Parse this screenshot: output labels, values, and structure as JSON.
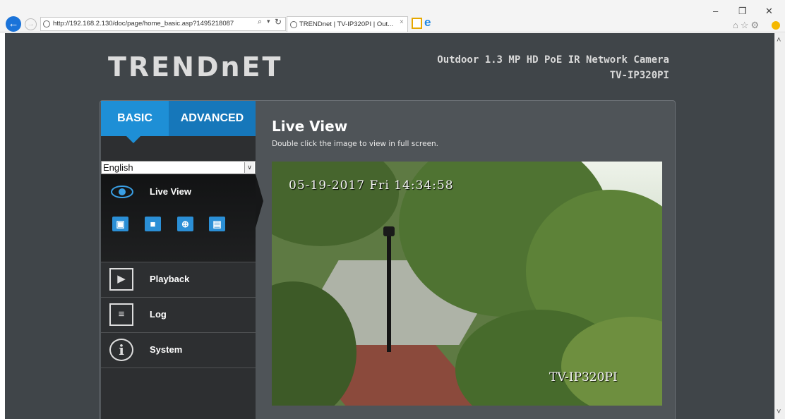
{
  "browser": {
    "url": "http://192.168.2.130/doc/page/home_basic.asp?1495218087",
    "search_glyph": "⌕",
    "dropdown_glyph": "▾",
    "refresh_glyph": "↻",
    "tab_title": "TRENDnet | TV-IP320PI | Out...",
    "tab_close": "×",
    "minimize": "–",
    "restore": "❐",
    "close": "✕",
    "back_glyph": "←",
    "forward_glyph": "→",
    "toolbar_glyphs": "⌂☆⚙",
    "ie_glyph": "e"
  },
  "header": {
    "logo": "TRENDnET",
    "model_line1": "Outdoor 1.3 MP HD PoE IR Network Camera",
    "model_line2": "TV-IP320PI"
  },
  "tabs": {
    "basic": "BASIC",
    "advanced": "ADVANCED"
  },
  "language": {
    "selected": "English",
    "arrow": "∨"
  },
  "sidebar": {
    "live_view": "Live View",
    "playback": "Playback",
    "log": "Log",
    "system": "System",
    "icons": {
      "snapshot": "▣",
      "record": "■",
      "zoom": "⊕",
      "film": "▤",
      "playback": "▶",
      "log": "≡",
      "system": "i"
    }
  },
  "content": {
    "title": "Live View",
    "subtitle": "Double click the image to view in full screen.",
    "timestamp": "05-19-2017 Fri 14:34:58",
    "camera_name": "TV-IP320PI"
  },
  "scrollbar": {
    "up": "˄",
    "down": "˅"
  }
}
